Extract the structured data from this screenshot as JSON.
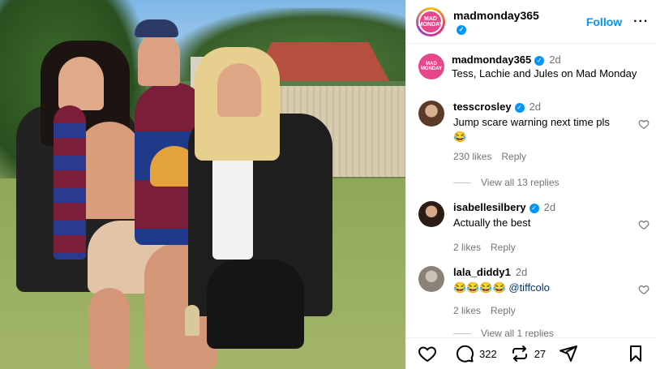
{
  "header": {
    "username": "madmonday365",
    "avatar_text": "MAD MONDAY",
    "follow_label": "Follow",
    "more_label": "···"
  },
  "caption": {
    "username": "madmonday365",
    "time": "2d",
    "text": "Tess, Lachie and Jules on Mad Monday",
    "avatar_text": "MAD MONDAY"
  },
  "comments": [
    {
      "username": "tesscrosley",
      "time": "2d",
      "text": "Jump scare warning next time pls",
      "emoji": "😂",
      "likes": "230 likes",
      "reply": "Reply",
      "view_replies": "View all 13 replies"
    },
    {
      "username": "isabellesilbery",
      "time": "2d",
      "text": "Actually the best",
      "likes": "2 likes",
      "reply": "Reply"
    },
    {
      "username": "lala_diddy1",
      "time": "2d",
      "emoji": "😂😂😂😂",
      "mention": "@tiffcolo",
      "likes": "2 likes",
      "reply": "Reply",
      "view_replies": "View all 1 replies"
    }
  ],
  "actions": {
    "comments_count": "322",
    "reposts_count": "27"
  },
  "icons": [
    "verified-icon",
    "more-icon",
    "heart-icon",
    "comment-icon",
    "repost-icon",
    "share-icon",
    "bookmark-icon"
  ],
  "colors": {
    "accent": "#0095f6",
    "muted": "#737373",
    "mention": "#00376b"
  }
}
